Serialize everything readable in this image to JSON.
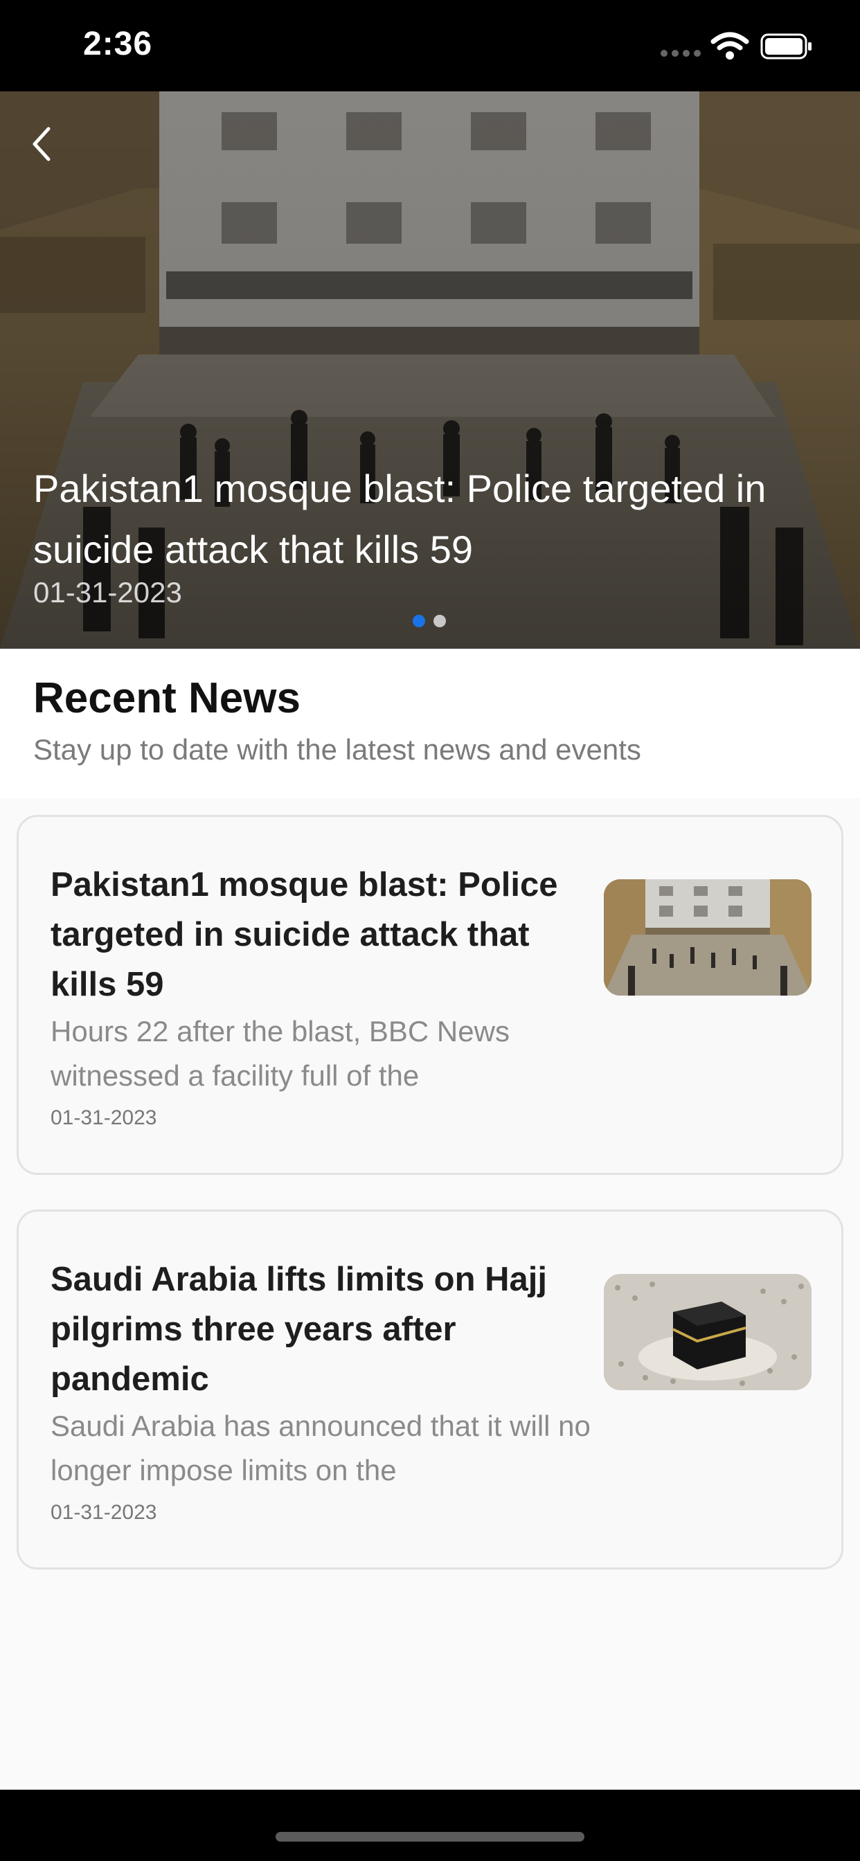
{
  "status_bar": {
    "time": "2:36"
  },
  "hero": {
    "title": "Pakistan1 mosque blast: Police targeted in suicide attack that kills 59",
    "date": "01-31-2023",
    "pager": {
      "total": 2,
      "active_index": 0
    }
  },
  "section": {
    "title": "Recent News",
    "subtitle": "Stay up to date with the latest news and events"
  },
  "articles": [
    {
      "title": "Pakistan1 mosque blast: Police targeted in suicide attack that kills 59",
      "excerpt": "Hours 22 after the blast, BBC News witnessed a facility full of the",
      "date": "01-31-2023",
      "thumbnail": "mosque-rubble-photo"
    },
    {
      "title": "Saudi Arabia lifts limits on Hajj pilgrims three years after pandemic",
      "excerpt": "Saudi Arabia has announced that it will no longer impose limits on the",
      "date": "01-31-2023",
      "thumbnail": "kaaba-crowd-photo"
    }
  ],
  "icons": {
    "back": "chevron-left-icon",
    "wifi": "wifi-icon",
    "battery": "battery-icon"
  },
  "colors": {
    "accent": "#1a73e8",
    "background": "#fafafa",
    "card_border": "#e2e2e2"
  }
}
